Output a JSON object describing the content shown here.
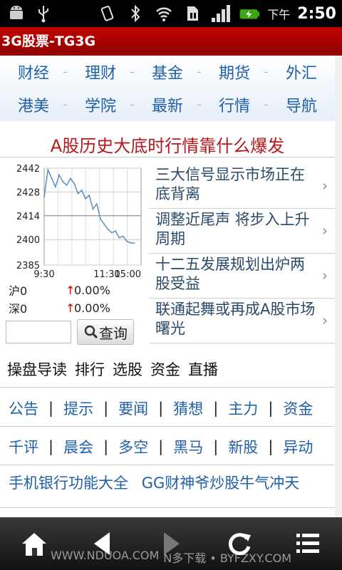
{
  "status_bar": {
    "icons": [
      "android-icon",
      "usb-icon",
      "vibrate-icon",
      "bluetooth-icon",
      "wifi-icon",
      "sim-icon",
      "signal-icon",
      "battery-charging-icon"
    ],
    "ampm": "下午",
    "time": "2:50"
  },
  "app": {
    "title": "3G股票-TG3G"
  },
  "nav": {
    "row1": [
      "财经",
      "理财",
      "基金",
      "期货",
      "外汇"
    ],
    "row2": [
      "港美",
      "学院",
      "最新",
      "行情",
      "导航"
    ]
  },
  "headline": {
    "text": "A股历史大底时行情靠什么爆发"
  },
  "chart_data": {
    "type": "line",
    "x": [
      "9:30",
      "11:30",
      "15:00"
    ],
    "yticks": [
      2442,
      2428,
      2414,
      2400,
      2385
    ],
    "ylim": [
      2385,
      2442
    ],
    "series": [
      {
        "values": [
          2425,
          2441,
          2436,
          2431,
          2438,
          2434,
          2432,
          2436,
          2433,
          2427,
          2429,
          2424,
          2426,
          2418,
          2421,
          2412,
          2409,
          2406,
          2404,
          2405,
          2401,
          2402,
          2399,
          2398,
          2398
        ]
      }
    ],
    "grid": true,
    "line_color": "#5a8fc0"
  },
  "indices": [
    {
      "name": "沪0",
      "arrow": "↑",
      "pct": "0.00%"
    },
    {
      "name": "深0",
      "arrow": "↑",
      "pct": "0.00%"
    }
  ],
  "search": {
    "button_label": "查询",
    "placeholder": ""
  },
  "news": [
    "三大信号显示市场正在底背离",
    "调整近尾声 将步入上升周期",
    "十二五发展规划出炉两股受益",
    "联通起舞或再成A股市场曙光"
  ],
  "tabs": [
    "操盘导读",
    "排行",
    "选股",
    "资金",
    "直播"
  ],
  "links_row1": [
    "公告",
    "提示",
    "要闻",
    "猜想",
    "主力",
    "资金"
  ],
  "links_row2": [
    "千评",
    "晨会",
    "多空",
    "黑马",
    "新股",
    "异动"
  ],
  "promo": [
    "手机银行功能大全",
    "GG财神爷炒股牛气冲天"
  ],
  "bottom_bar": {
    "buttons": [
      "home-icon",
      "back-icon",
      "forward-icon",
      "refresh-icon",
      "menu-icon"
    ]
  },
  "watermark": [
    "WWW.NDUOA.COM",
    "N多下载 • BYFZXY.COM"
  ]
}
